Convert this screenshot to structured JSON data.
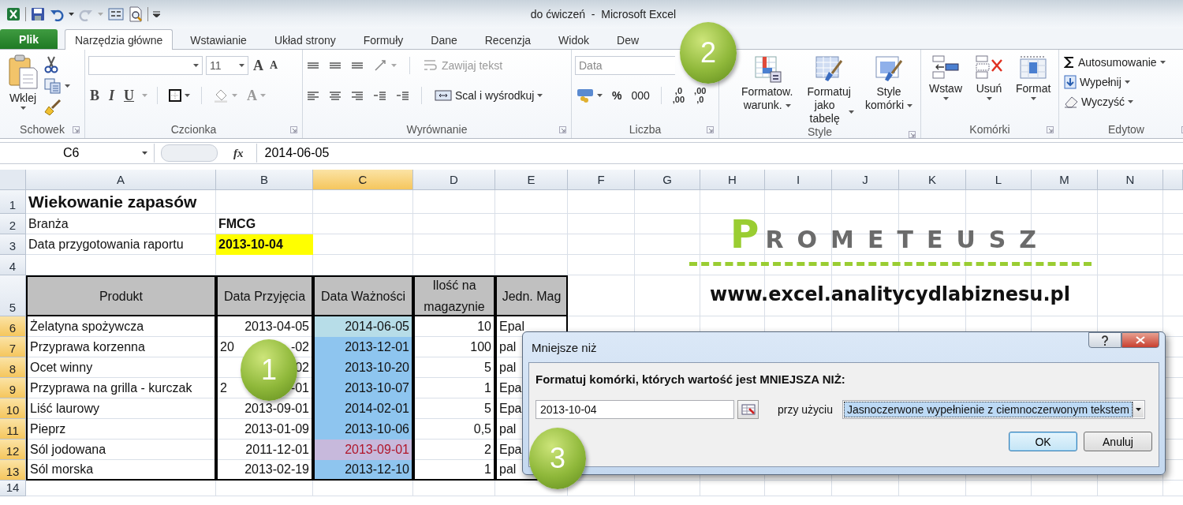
{
  "window": {
    "title": "do ćwiczeń  -  Microsoft Excel"
  },
  "file_tab": "Plik",
  "tabs": [
    {
      "label": "Narzędzia główne",
      "selected": true
    },
    {
      "label": "Wstawianie",
      "selected": false
    },
    {
      "label": "Układ strony",
      "selected": false
    },
    {
      "label": "Formuły",
      "selected": false
    },
    {
      "label": "Dane",
      "selected": false
    },
    {
      "label": "Recenzja",
      "selected": false
    },
    {
      "label": "Widok",
      "selected": false
    },
    {
      "label": "Dew",
      "selected": false
    }
  ],
  "ribbon": {
    "clipboard": {
      "paste": "Wklej",
      "label": "Schowek"
    },
    "font": {
      "size": "11",
      "grow": "A",
      "shrink": "A",
      "styles": [
        "B",
        "I",
        "U"
      ],
      "font_color_button": "A",
      "label": "Czcionka"
    },
    "alignment": {
      "wrap": {
        "label": "Zawijaj tekst",
        "disabled": true
      },
      "merge": {
        "label": "Scal i wyśrodkuj",
        "disabled": false
      },
      "label": "Wyrównanie"
    },
    "number": {
      "format": "Data",
      "percent": "%",
      "thousands": "000",
      "decimals": [
        {
          "top": ",0",
          "bottom": ",00"
        },
        {
          "top": ",00",
          "bottom": ",0"
        }
      ],
      "label": "Liczba"
    },
    "styles": {
      "buttons": [
        {
          "lines": [
            "Formatow.",
            "warunk."
          ],
          "kind": "conditional"
        },
        {
          "lines": [
            "Formatuj",
            "jako tabelę"
          ],
          "kind": "table"
        },
        {
          "lines": [
            "Style",
            "komórki"
          ],
          "kind": "cellstyle"
        }
      ],
      "label": "Style"
    },
    "cells": {
      "buttons": [
        {
          "label": "Wstaw",
          "kind": "insert"
        },
        {
          "label": "Usuń",
          "kind": "delete"
        },
        {
          "label": "Format",
          "kind": "format"
        }
      ],
      "label": "Komórki"
    },
    "editing": {
      "items": [
        {
          "label": "Autosumowanie",
          "kind": "sum"
        },
        {
          "label": "Wypełnij",
          "kind": "fill"
        },
        {
          "label": "Wyczyść",
          "kind": "clear"
        }
      ],
      "label": "Edytow"
    }
  },
  "formula_bar": {
    "name_box": "C6",
    "function_label": "fx",
    "value": "2014-06-05"
  },
  "sheet": {
    "columns": [
      {
        "label": "A",
        "selected": false
      },
      {
        "label": "B",
        "selected": false
      },
      {
        "label": "C",
        "selected": true
      },
      {
        "label": "D",
        "selected": false
      },
      {
        "label": "E",
        "selected": false
      },
      {
        "label": "F",
        "selected": false
      },
      {
        "label": "G",
        "selected": false
      },
      {
        "label": "H",
        "selected": false
      },
      {
        "label": "I",
        "selected": false
      },
      {
        "label": "J",
        "selected": false
      },
      {
        "label": "K",
        "selected": false
      },
      {
        "label": "L",
        "selected": false
      },
      {
        "label": "M",
        "selected": false
      },
      {
        "label": "N",
        "selected": false
      }
    ],
    "rows": [
      {
        "number": "1",
        "selected": false,
        "kind": "title",
        "cells": [
          "Wiekowanie zapasów"
        ]
      },
      {
        "number": "2",
        "selected": false,
        "kind": "plain",
        "cells": [
          "Branża",
          {
            "text": "FMCG",
            "kind": "bold"
          }
        ]
      },
      {
        "number": "3",
        "selected": false,
        "kind": "plain",
        "cells": [
          "Data przygotowania raportu",
          {
            "text": "2013-10-04",
            "kind": "highlight"
          }
        ]
      },
      {
        "number": "4",
        "selected": false,
        "kind": "plain"
      },
      {
        "number": "5",
        "selected": false,
        "kind": "header",
        "cells": [
          "Produkt",
          "Data Przyjęcia",
          "Data Ważności",
          "Ilość na magazynie",
          "Jedn. Mag"
        ]
      },
      {
        "number": "6",
        "selected": true,
        "kind": "data",
        "cells": [
          "Żelatyna spożywcza",
          "2013-04-05",
          {
            "text": "2014-06-05",
            "kind": "active"
          },
          "10",
          "Epal"
        ]
      },
      {
        "number": "7",
        "selected": true,
        "kind": "data",
        "cells": [
          "Przyprawa korzenna",
          {
            "parts": [
              "20",
              "-02"
            ]
          },
          {
            "text": "2013-12-01",
            "kind": "range"
          },
          "100",
          "pal"
        ]
      },
      {
        "number": "8",
        "selected": true,
        "kind": "data",
        "cells": [
          "Ocet winny",
          {
            "parts": [
              "02"
            ]
          },
          {
            "text": "2013-10-20",
            "kind": "range"
          },
          "5",
          "pal"
        ]
      },
      {
        "number": "9",
        "selected": true,
        "kind": "data",
        "cells": [
          "Przyprawa na grilla - kurczak",
          {
            "parts": [
              "2",
              "-01"
            ]
          },
          {
            "text": "2013-10-07",
            "kind": "range"
          },
          "1",
          "Epa"
        ]
      },
      {
        "number": "10",
        "selected": true,
        "kind": "data",
        "cells": [
          "Liść laurowy",
          "2013-09-01",
          {
            "text": "2014-02-01",
            "kind": "range"
          },
          "5",
          "Epa"
        ]
      },
      {
        "number": "11",
        "selected": true,
        "kind": "data",
        "cells": [
          "Pieprz",
          "2013-01-09",
          {
            "text": "2013-10-06",
            "kind": "range"
          },
          "0,5",
          "pal"
        ]
      },
      {
        "number": "12",
        "selected": true,
        "kind": "data",
        "cells": [
          "Sól jodowana",
          "2011-12-01",
          {
            "text": "2013-09-01",
            "kind": "flagged"
          },
          "2",
          "Epa"
        ]
      },
      {
        "number": "13",
        "selected": true,
        "kind": "data",
        "cells": [
          "Sól morska",
          "2013-02-19",
          {
            "text": "2013-12-10",
            "kind": "range"
          },
          "1",
          "pal"
        ]
      },
      {
        "number": "14",
        "selected": false,
        "kind": "plain"
      }
    ]
  },
  "logo": {
    "name": "PROMETEUSZ",
    "url": "www.excel.analitycydlabiznesu.pl"
  },
  "dialog": {
    "title": "Mniejsze niż",
    "prompt": "Formatuj komórki, których wartość jest MNIEJSZA NIŻ:",
    "value": "2013-10-04",
    "using_label": "przy użyciu",
    "format": "Jasnoczerwone wypełnienie z ciemnoczerwonym tekstem",
    "buttons": [
      {
        "label": "OK",
        "default": true
      },
      {
        "label": "Anuluj",
        "default": false
      }
    ]
  },
  "callouts": [
    "1",
    "2",
    "3"
  ]
}
